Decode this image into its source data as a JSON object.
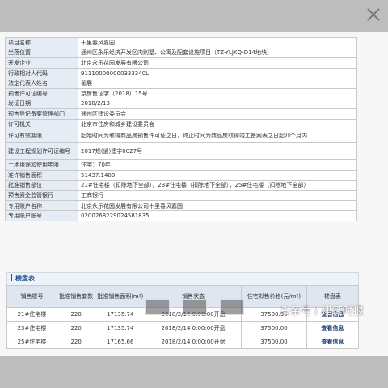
{
  "info_rows": [
    {
      "k": "项目名称",
      "v": "十里春风嘉园"
    },
    {
      "k": "坐落位置",
      "v": "通州区永乐经济开发区内别墅、公寓及配套设施项目（TZ-YLJKQ-D14地块）"
    },
    {
      "k": "开发企业",
      "v": "北京永乐花园发展有限公司"
    },
    {
      "k": "行政相对人代码",
      "v": "911100000000333340L"
    },
    {
      "k": "法定代表人姓名",
      "v": "翟展"
    },
    {
      "k": "预售许可证编号",
      "v": "京房售证字（2018）15号"
    },
    {
      "k": "发证日期",
      "v": "2018/2/13"
    },
    {
      "k": "预售登记备案管理部门",
      "v": "通州区建设委员会"
    },
    {
      "k": "许可机关",
      "v": "北京市住房和城乡建设委员会"
    },
    {
      "k": "许可有效期限",
      "v": "起始时间为取得商品房预售许可证之日，终止时间为商品房取得竣工备案表之日起四个月内"
    },
    {
      "k": "建设工程规划许可证编号",
      "v": "2017规(通)建字0027号"
    },
    {
      "k": "土地用途和使用年限",
      "v": "住宅：70年"
    },
    {
      "k": "准许销售面积",
      "v": "51437.1400"
    },
    {
      "k": "批准销售部位",
      "v": "21#住宅楼（扣除地下全部），23#住宅楼（扣除地下全部），25#住宅楼（扣除地下全部）"
    },
    {
      "k": "预售资金监管银行",
      "v": "工商银行"
    },
    {
      "k": "专用账户名称",
      "v": "北京永乐花园发展有限公司十里春风嘉园"
    },
    {
      "k": "专用账户账号",
      "v": "0200268229024581835"
    }
  ],
  "section_title": "楼盘表",
  "sales_headers": [
    "销售楼号",
    "批准销售套数",
    "批准销售面积(m²)",
    "销售状态",
    "住宅拟售价格(元/m²)",
    "楼盘表"
  ],
  "sales_rows": [
    {
      "building": "21#住宅楼",
      "units": "220",
      "area": "17135.74",
      "status": "2018/2/14 0:00:00开盘",
      "price": "37500.00",
      "link": "查看信息"
    },
    {
      "building": "23#住宅楼",
      "units": "220",
      "area": "17135.74",
      "status": "2018/2/14 0:00:00开盘",
      "price": "37500.00",
      "link": "查看信息"
    },
    {
      "building": "25#住宅楼",
      "units": "220",
      "area": "17165.66",
      "status": "2018/2/14 0:00:00开盘",
      "price": "37500.00",
      "link": "查看信息"
    }
  ],
  "watermark": "头条号 / 建筑时报",
  "colors": {
    "accent": "#1f4f8a",
    "header_bg": "#e6ecf5"
  }
}
